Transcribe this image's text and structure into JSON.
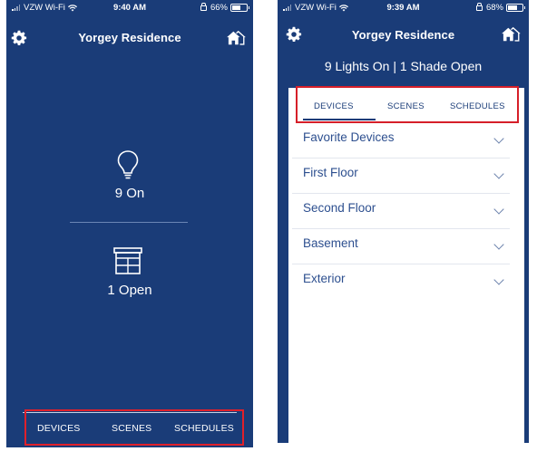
{
  "colors": {
    "primary": "#1a3c78",
    "highlight": "#e0202b",
    "panel": "#ffffff"
  },
  "screen_left": {
    "status": {
      "carrier": "VZW Wi-Fi",
      "time": "9:40 AM",
      "battery": "66%",
      "battery_level": 0.66
    },
    "header": {
      "title": "Yorgey Residence",
      "left_icon": "gear-icon",
      "right_icon": "home-icon"
    },
    "lights": {
      "icon": "lightbulb-icon",
      "text": "9 On"
    },
    "shades": {
      "icon": "window-shade-icon",
      "text": "1 Open"
    },
    "tabs": [
      "DEVICES",
      "SCENES",
      "SCHEDULES"
    ]
  },
  "screen_right": {
    "status": {
      "carrier": "VZW Wi-Fi",
      "time": "9:39 AM",
      "battery": "68%",
      "battery_level": 0.68
    },
    "header": {
      "title": "Yorgey Residence",
      "summary": "9 Lights On | 1 Shade Open",
      "left_icon": "gear-icon",
      "right_icon": "home-icon"
    },
    "tabs": [
      "DEVICES",
      "SCENES",
      "SCHEDULES"
    ],
    "active_tab": "DEVICES",
    "sections": [
      "Favorite Devices",
      "First Floor",
      "Second Floor",
      "Basement",
      "Exterior"
    ]
  }
}
